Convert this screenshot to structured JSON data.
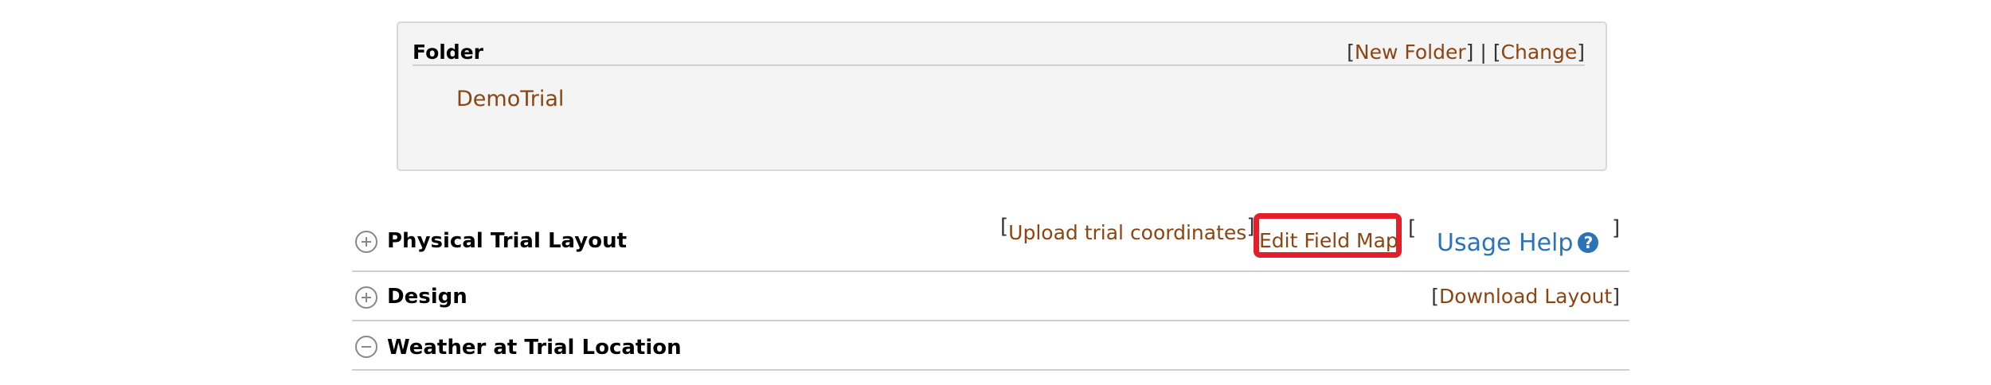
{
  "folder": {
    "title": "Folder",
    "name": "DemoTrial",
    "actions": {
      "new_folder": "New Folder",
      "separator": "|",
      "change": "Change"
    }
  },
  "sections": {
    "physical_layout": {
      "title": "Physical Trial Layout",
      "upload_link": "Upload trial coordinates",
      "edit_link": "Edit Field Map",
      "help_link": "Usage Help",
      "help_icon": "?"
    },
    "design": {
      "title": "Design",
      "download_link": "Download Layout"
    },
    "weather": {
      "title": "Weather at Trial Location"
    }
  },
  "colors": {
    "link": "#8b4513",
    "help_link": "#2a73b8",
    "highlight": "#e3202a"
  },
  "icons": {
    "expand": "plus-circle-icon",
    "collapse": "minus-circle-icon",
    "help": "question-circle-icon"
  }
}
